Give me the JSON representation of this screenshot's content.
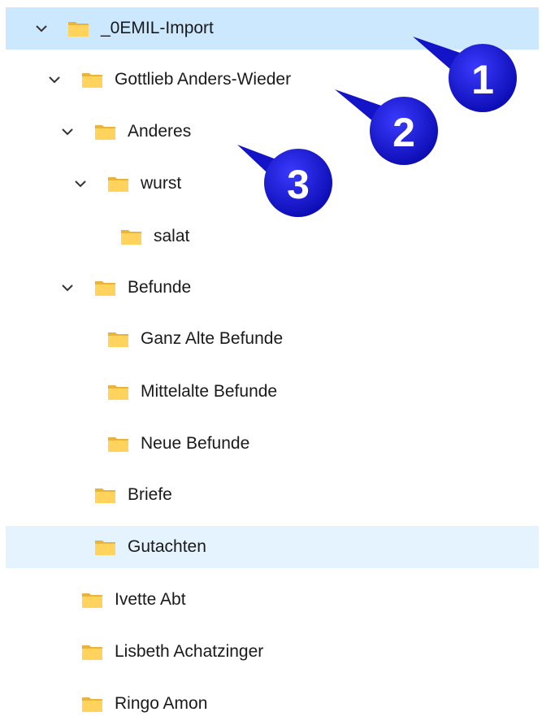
{
  "tree": {
    "items": [
      {
        "label": "_0EMIL-Import",
        "expanded": true
      },
      {
        "label": "Gottlieb Anders-Wieder",
        "expanded": true
      },
      {
        "label": "Anderes",
        "expanded": true
      },
      {
        "label": "wurst",
        "expanded": true
      },
      {
        "label": "salat",
        "expanded": false
      },
      {
        "label": "Befunde",
        "expanded": true
      },
      {
        "label": "Ganz Alte Befunde",
        "expanded": false
      },
      {
        "label": "Mittelalte Befunde",
        "expanded": false
      },
      {
        "label": "Neue Befunde",
        "expanded": false
      },
      {
        "label": "Briefe",
        "expanded": false
      },
      {
        "label": "Gutachten",
        "expanded": false
      },
      {
        "label": "Ivette Abt",
        "expanded": false
      },
      {
        "label": "Lisbeth Achatzinger",
        "expanded": false
      },
      {
        "label": "Ringo Amon",
        "expanded": false
      }
    ],
    "selected_index": 0,
    "hover_index": 10
  },
  "callouts": [
    "1",
    "2",
    "3"
  ],
  "colors": {
    "selection": "#cce8ff",
    "hover": "#e5f3ff",
    "folder_back": "#e8b53a",
    "folder_front": "#ffd35c",
    "callout_fill": "#1313c8"
  },
  "icons": {
    "expander": "chevron-down-icon",
    "folder": "folder-icon"
  }
}
